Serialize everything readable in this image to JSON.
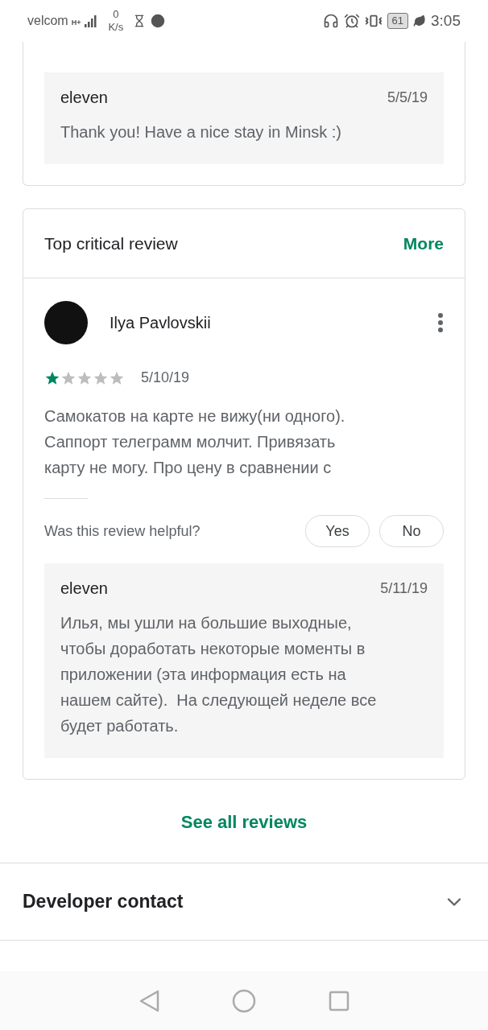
{
  "status_bar": {
    "carrier": "velcom",
    "network": "H+",
    "speed_value": "0",
    "speed_unit": "K/s",
    "battery": "61",
    "time": "3:05"
  },
  "previous_review": {
    "reply": {
      "author": "eleven",
      "date": "5/5/19",
      "text": "Thank you! Have a nice stay in Minsk :)"
    }
  },
  "critical_review": {
    "title": "Top critical review",
    "more": "More",
    "reviewer": "Ilya Pavlovskii",
    "stars": 1,
    "date": "5/10/19",
    "text": "Самокатов на карте не вижу(ни одного). Саппорт телеграмм молчит. Привязать карту не могу. Про цену в сравнении с",
    "helpful_question": "Was this review helpful?",
    "buttons": [
      "Yes",
      "No"
    ],
    "reply": {
      "author": "eleven",
      "date": "5/11/19",
      "text": "Илья, мы ушли на большие выходные, чтобы доработать некоторые моменты в приложении (эта информация есть на нашем сайте).  На следующей неделе все будет работать."
    }
  },
  "see_all": "See all reviews",
  "developer_contact": {
    "title": "Developer contact",
    "expanded": false
  }
}
